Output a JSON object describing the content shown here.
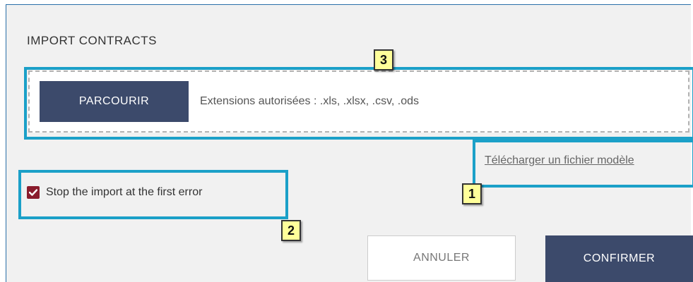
{
  "dialog": {
    "title": "IMPORT CONTRACTS"
  },
  "upload": {
    "browse_label": "PARCOURIR",
    "extensions_text": "Extensions autorisées : .xls, .xlsx, .csv, .ods",
    "download_template_label": "Télécharger un fichier modèle"
  },
  "options": {
    "stop_on_first_error_label": "Stop the import at the first error",
    "stop_on_first_error_checked": true
  },
  "actions": {
    "cancel_label": "ANNULER",
    "confirm_label": "CONFIRMER"
  },
  "callouts": {
    "one": "1",
    "two": "2",
    "three": "3"
  },
  "colors": {
    "primary_button": "#3c4a6b",
    "highlight": "#1ba0c8",
    "checkbox": "#8a1c2c",
    "callout_bg": "#ffff9a"
  }
}
